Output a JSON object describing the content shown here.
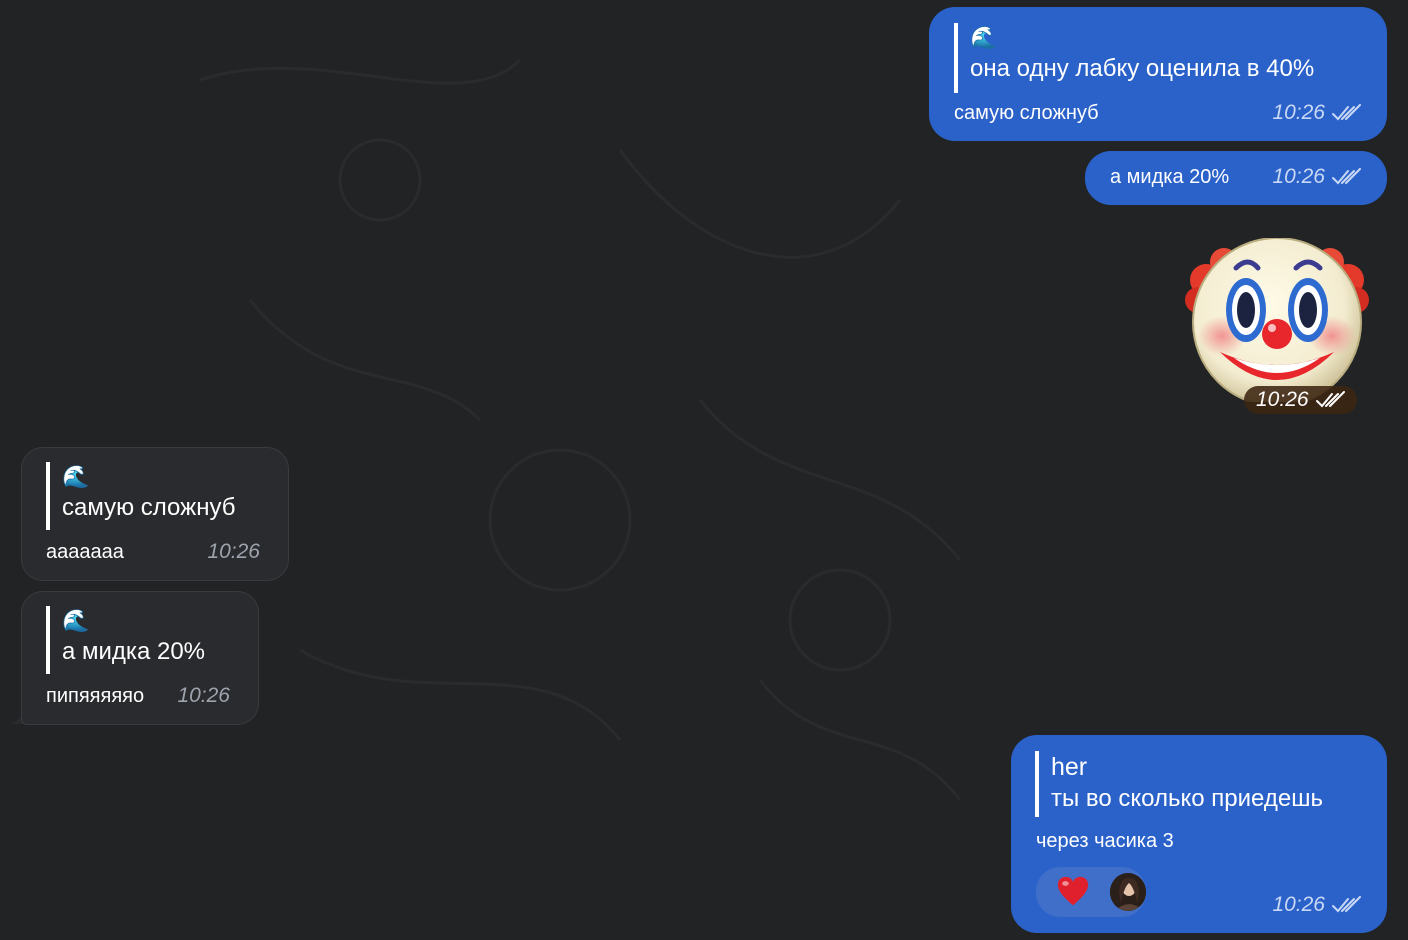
{
  "messages": [
    {
      "id": "m1",
      "direction": "outgoing",
      "quote_emoji": "🌊",
      "quote_text": "она одну лабку оценила в 40%",
      "text": "самую сложнуб",
      "time": "10:26",
      "status": "read"
    },
    {
      "id": "m2",
      "direction": "outgoing",
      "text": "а мидка 20%",
      "time": "10:26",
      "status": "read"
    },
    {
      "id": "m3",
      "direction": "outgoing",
      "sticker": "clown-face",
      "time": "10:26",
      "status": "read"
    },
    {
      "id": "m4",
      "direction": "incoming",
      "quote_emoji": "🌊",
      "quote_text": "самую сложнуб",
      "text": "ааааааа",
      "time": "10:26"
    },
    {
      "id": "m5",
      "direction": "incoming",
      "quote_emoji": "🌊",
      "quote_text": "а мидка 20%",
      "text": "пипяяяяяо",
      "time": "10:26"
    },
    {
      "id": "m6",
      "direction": "outgoing",
      "quote_author": "her",
      "quote_text": "ты во сколько приедешь",
      "text": "через часика 3",
      "time": "10:26",
      "status": "read",
      "reactions": [
        "heart"
      ]
    }
  ],
  "colors": {
    "background": "#222325",
    "outgoing_bubble": "#2b62c9",
    "incoming_bubble": "#2a2b2e",
    "reaction_pill": "#3f6fc9"
  },
  "icons": [
    "wave-emoji",
    "double-check-icon",
    "clown-face-sticker",
    "heart-reaction-icon",
    "reactor-avatar"
  ]
}
